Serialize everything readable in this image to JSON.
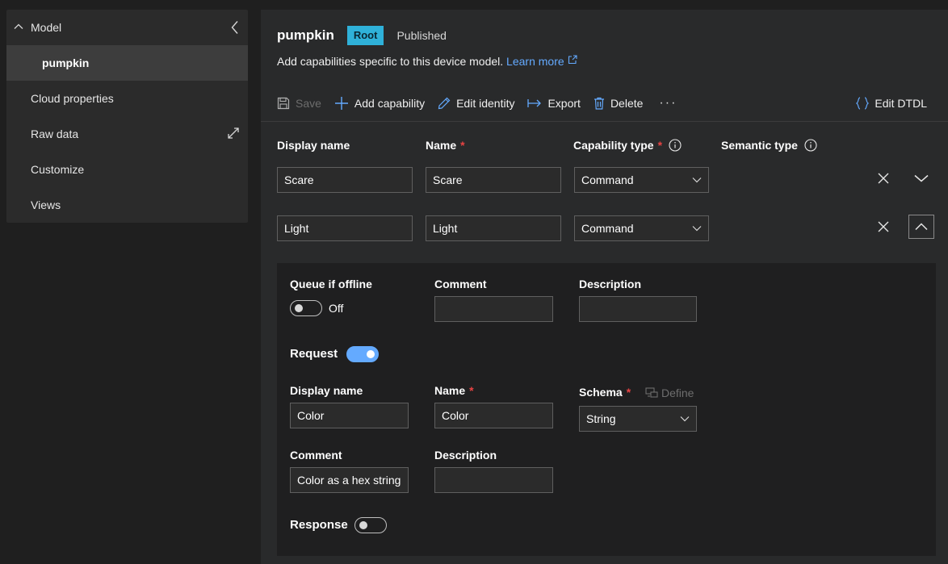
{
  "sidebar": {
    "header_label": "Model",
    "items": [
      {
        "label": "pumpkin"
      },
      {
        "label": "Cloud properties"
      },
      {
        "label": "Raw data"
      },
      {
        "label": "Customize"
      },
      {
        "label": "Views"
      }
    ]
  },
  "header": {
    "title": "pumpkin",
    "badge": "Root",
    "status": "Published",
    "subtitle": "Add capabilities specific to this device model.",
    "learn_more": "Learn more"
  },
  "toolbar": {
    "save": "Save",
    "add_capability": "Add capability",
    "edit_identity": "Edit identity",
    "export": "Export",
    "delete": "Delete",
    "more": "···",
    "edit_dtdl": "Edit DTDL"
  },
  "columns": {
    "display_name": "Display name",
    "name": "Name",
    "capability_type": "Capability type",
    "semantic_type": "Semantic type",
    "required_mark": "*"
  },
  "capabilities": [
    {
      "display_name": "Scare",
      "name": "Scare",
      "type": "Command"
    },
    {
      "display_name": "Light",
      "name": "Light",
      "type": "Command"
    }
  ],
  "detail": {
    "queue_label": "Queue if offline",
    "queue_state": "Off",
    "comment_label": "Comment",
    "description_label": "Description",
    "comment_value": "",
    "description_value": "",
    "request_label": "Request",
    "request": {
      "display_name_label": "Display name",
      "display_name_value": "Color",
      "name_label": "Name",
      "name_value": "Color",
      "schema_label": "Schema",
      "schema_value": "String",
      "define_label": "Define",
      "comment_label": "Comment",
      "comment_value": "Color as a hex string",
      "description_label": "Description",
      "description_value": ""
    },
    "response_label": "Response"
  },
  "colors": {
    "accent": "#64aaff",
    "badge": "#2fb1d9",
    "required": "#e84343",
    "background": "#1f1f1f",
    "panel": "#292a2b"
  },
  "icons": [
    "chevron-up-icon",
    "chevron-left-icon",
    "expand-icon",
    "save-icon",
    "plus-icon",
    "pencil-icon",
    "export-icon",
    "trash-icon",
    "braces-icon",
    "info-icon",
    "close-icon",
    "chevron-down-icon",
    "external-link-icon",
    "define-icon"
  ]
}
